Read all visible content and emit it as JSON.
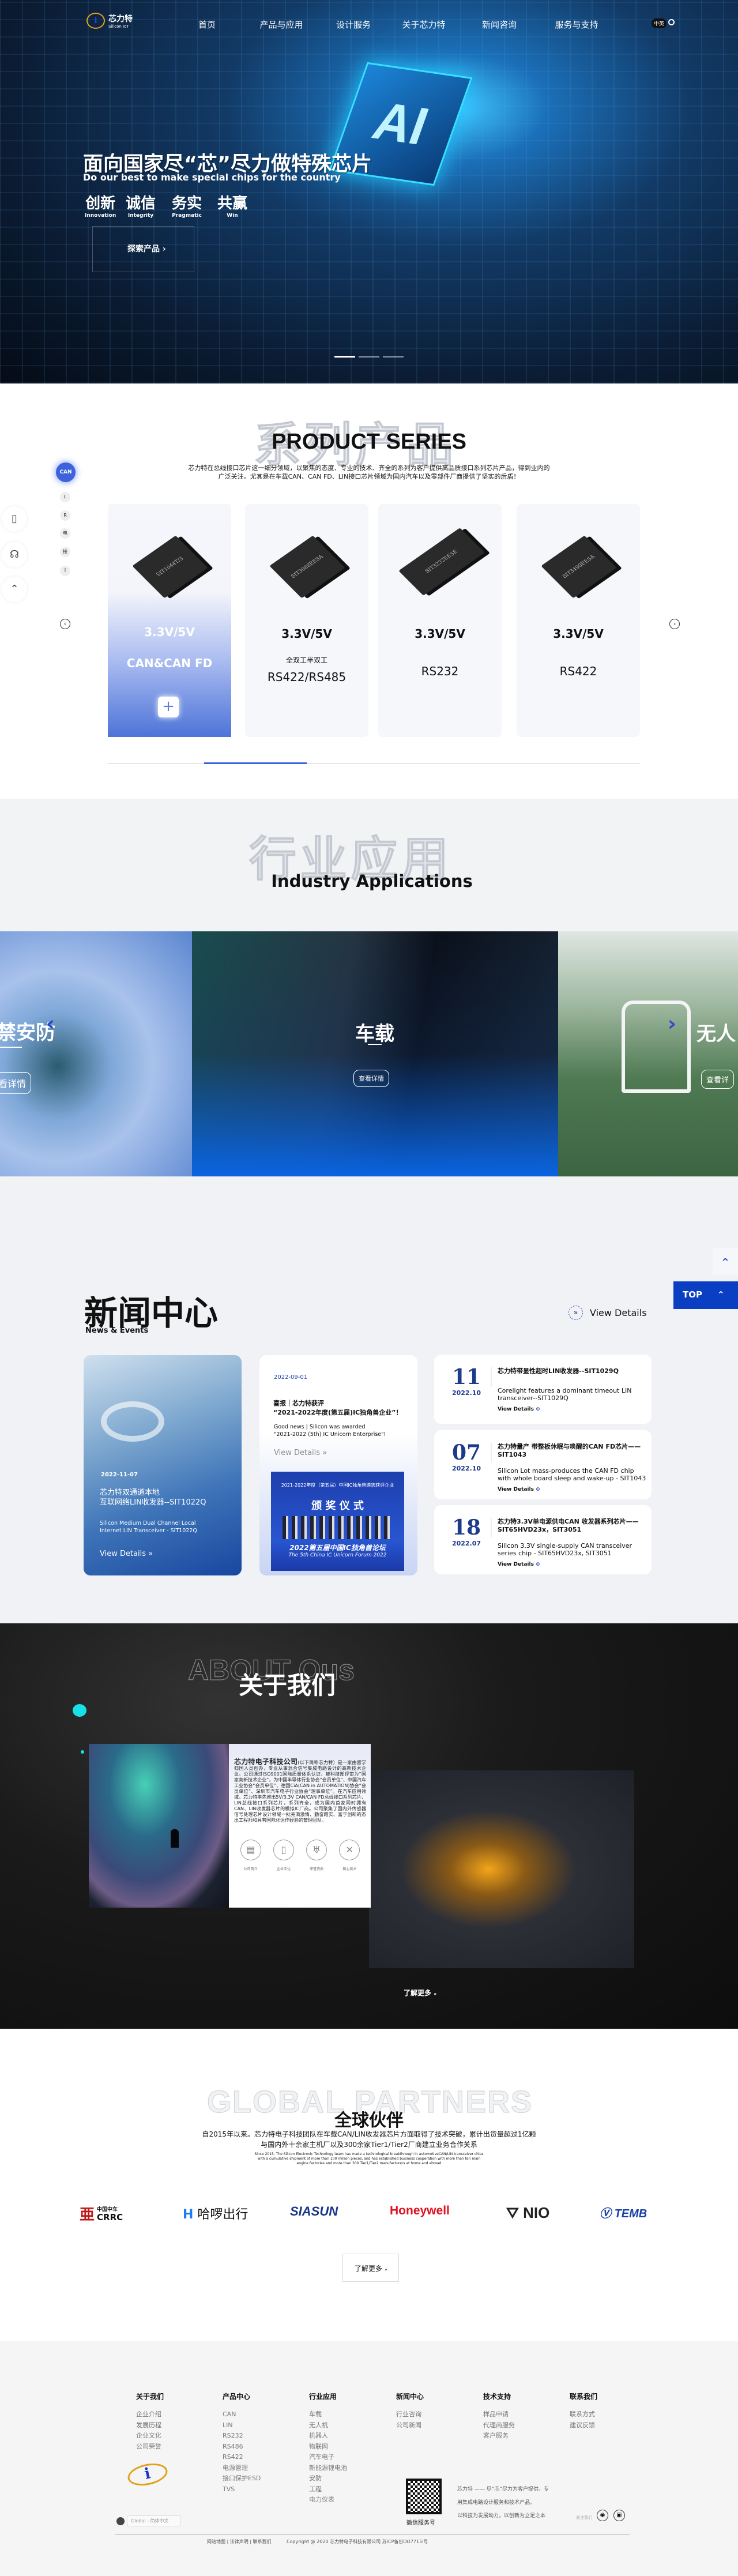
{
  "nav": {
    "logo_cn": "芯力特",
    "logo_en": "Silicon IoT",
    "items": [
      "首页",
      "产品与应用",
      "设计服务",
      "关于芯力特",
      "新闻咨询",
      "服务与支持"
    ],
    "lang": "中英"
  },
  "hero": {
    "chip_text": "AI",
    "title": "面向国家尽“芯”尽力做特殊芯片",
    "subtitle": "Do our best to make special chips for the country",
    "values": [
      {
        "cn": "创新",
        "en": "Innovation"
      },
      {
        "cn": "诚信",
        "en": "Integrity"
      },
      {
        "cn": "务实",
        "en": "Pragmatic"
      },
      {
        "cn": "共赢",
        "en": "Win"
      }
    ],
    "explore": "探索产品"
  },
  "products": {
    "bg_title": "系列产品",
    "title": "PRODUCT SERIES",
    "desc1": "芯力特在总线接口芯片这一细分领域，以聚焦的态度、专业的技术、齐全的系列为客户提供高品质接口系列芯片产品，得到业内的",
    "desc2": "广泛关注。尤其是在车载CAN、CAN FD、LIN接口芯片领域为国内汽车以及零部件厂商提供了坚实的后盾！",
    "tabs": [
      "CAN",
      "L",
      "R",
      "电",
      "接",
      "T"
    ],
    "cards": [
      {
        "chip": "SIT1044T/3",
        "voltage": "3.3V/5V",
        "type": "",
        "name": "CAN&CAN FD"
      },
      {
        "chip": "SIT3088EESA",
        "voltage": "3.3V/5V",
        "type": "全双工半双工",
        "name": "RS422/RS485"
      },
      {
        "chip": "SIT3232EESE",
        "voltage": "3.3V/5V",
        "type": "",
        "name": "RS232"
      },
      {
        "chip": "SIT3490EESA",
        "voltage": "3.3V/5V",
        "type": "",
        "name": "RS422"
      }
    ],
    "active_page_fraction": 0.2
  },
  "industry": {
    "bg_title": "行业应用",
    "title": "Industry Applications",
    "panels": [
      {
        "label": "禁安防",
        "button": "看详情"
      },
      {
        "label": "车载",
        "button": "查看详情"
      },
      {
        "label": "无人",
        "button": "查看详"
      }
    ]
  },
  "news": {
    "title": "新闻中心",
    "subtitle": "News & Events",
    "view_all": "View Details",
    "top": "TOP",
    "featured": {
      "date": "2022-11-07",
      "title1": "芯力特双通道本地",
      "title2": "互联网络LIN收发器--SIT1022Q",
      "en1": "Silicon Medium Dual Channel Local",
      "en2": "Internet LIN Transceiver - SIT1022Q",
      "more": "View Details"
    },
    "middle": {
      "date": "2022-09-01",
      "title1": "喜报｜芯力特获评",
      "title2": "“2021-2022年度(第五届)IC独角兽企业”！",
      "en1": "Good news | Silicon was awarded",
      "en2": "\"2021-2022 (5th) IC Unicorn Enterprise\"!",
      "more": "View Details",
      "photo_top": "2021-2022年度（第五届）中国IC独角兽遴选获评企业",
      "photo_mid": "颁 奖 仪 式",
      "photo_b1": "2022第五届中国IC独角兽论坛",
      "photo_b2": "The 5th China IC Unicorn Forum 2022"
    },
    "list": [
      {
        "day": "11",
        "ym": "2022.10",
        "title": "芯力特带显性超时LIN收发器--SIT1029Q",
        "en": "Corelight features a dominant timeout LIN transceiver--SIT1029Q",
        "more": "View Details"
      },
      {
        "day": "07",
        "ym": "2022.10",
        "title": "芯力特量产 带整板休眠与唤醒的CAN FD芯片——SIT1043",
        "en": "Silicon Lot mass-produces the CAN FD chip with whole board sleep and wake-up - SIT1043",
        "more": "View Details"
      },
      {
        "day": "18",
        "ym": "2022.07",
        "title": "芯力特3.3V单电源供电CAN 收发器系列芯片——SIT65HVD23x，SIT3051",
        "en": "Silicon 3.3V single-supply CAN transceiver series chip - SIT65HVD23x, SIT3051",
        "more": "View Details"
      }
    ]
  },
  "about": {
    "bg_title": "ABOUT Ous",
    "title": "关于我们",
    "company": "芯力特电子科技公司",
    "body": "(以下简称芯力特）是一家由留学归国人员创办，专业从事混合信号集成电路设计的高新技术企业。公司通过ISO9001国际质量体系认证，被科技部评审为“国家高新技术企业”，为中国半导体行业协会“会员单位”、中国汽车工业协会“会员单位”、德国CiA(CAN in AUTOMATION)协会“会员单位”、深圳市汽车电子行业协会“理事单位”。在汽车应用领域，芯力特率先推出5V/3.3V CAN/CAN FD总线接口系列芯片、LIN总线接口系列芯片，系列齐全，成为国内首家同时拥有CAN、LIN收发器芯片的模拟IC厂商。公司聚集了国内外传感器信号处理芯片设计领域一批充满激情、勤奋踏实、富于创新的杰出工程师和具有国际化运作经验的管理团队。",
    "icons": [
      "公司简介",
      "企业文化",
      "荣誉资质",
      "核心技术"
    ],
    "more": "了解更多"
  },
  "partners": {
    "bg_title": "GLOBAL PARTNERS",
    "title": "全球伙伴",
    "desc1": "自2015年以来。芯力特电子科技团队在车载CAN/LIN收发器芯片方面取得了技术突破，累计出货量超过1亿颗",
    "desc2": "与国内外十余家主机厂以及300余家Tier1/Tier2厂商建立业务合作关系",
    "en1": "Since 2015, The Silicon Electronic Technology team has made a technological breakthrough in automotiveCAN/LIN transceiver chips",
    "en2": "with a cumulative shipment of more than 100 million pieces, and has established business cooperation with more than ten main",
    "en3": "engine factories and more than 300 Tier1/Tier2 manufacturers at home and abroad",
    "logos": [
      "中国中车",
      "CRRC",
      "哈啰出行",
      "SIASUN",
      "Honeywell",
      "NIO",
      "TEMB"
    ],
    "more": "了解更多"
  },
  "footer": {
    "cols": [
      {
        "h": "关于我们",
        "items": [
          "企业介绍",
          "发展历程",
          "企业文化",
          "公司荣誉"
        ]
      },
      {
        "h": "产品中心",
        "items": [
          "CAN",
          "LIN",
          "RS232",
          "RS486",
          "RS422",
          "电源管理",
          "接口保护ESD",
          "TVS"
        ]
      },
      {
        "h": "行业应用",
        "items": [
          "车载",
          "无人机",
          "机器人",
          "物联网",
          "汽车电子",
          "新能源锂电池",
          "安防",
          "工程",
          "电力仪表"
        ]
      },
      {
        "h": "新闻中心",
        "items": [
          "行业咨询",
          "公司新闻"
        ]
      },
      {
        "h": "技术支持",
        "items": [
          "样品申请",
          "代理商服务",
          "客户服务"
        ]
      },
      {
        "h": "联系我们",
        "items": [
          "联系方式",
          "建议反馈"
        ]
      }
    ],
    "qr_label": "微信服务号",
    "slogan1": "芯力特 —— 尽“芯”尽力为客户提供，专",
    "slogan2": "用集成电路设计服务和技术产品。",
    "slogan3": "以科技为发展动力，以创新为立足之本",
    "lang_select": "Global - 简体中文",
    "follow": "关注我们",
    "links": "网站地图 | 法律声明 | 联系我们",
    "copyright": "Copyright @ 2020 芯力特电子科技有限公司 苏ICP备份DO7715l号"
  }
}
